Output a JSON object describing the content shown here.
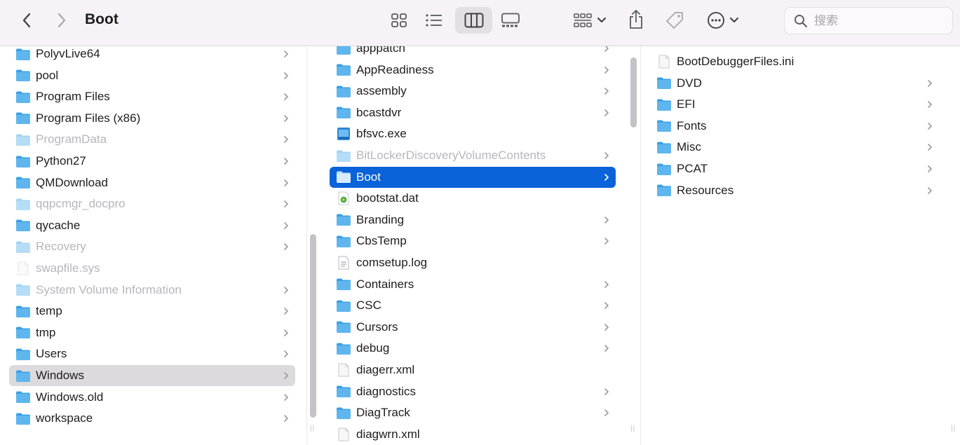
{
  "window": {
    "title": "Boot"
  },
  "toolbar": {
    "back_icon": "chevron-left-icon",
    "forward_icon": "chevron-right-icon",
    "views": [
      "icon-view",
      "list-view",
      "column-view",
      "gallery-view"
    ],
    "selected_view": "column-view",
    "group_icon": "group-icon",
    "share_icon": "share-icon",
    "tag_icon": "tag-icon",
    "more_icon": "ellipsis-icon"
  },
  "search": {
    "placeholder": "搜索",
    "value": ""
  },
  "colors": {
    "accent": "#0a63d8",
    "folder": "#5fb6ee",
    "sidebar_sel": "#dcdadd"
  },
  "column1": {
    "items": [
      {
        "name": "PolyvLive64",
        "kind": "folder",
        "dim": false,
        "chevron": true
      },
      {
        "name": "pool",
        "kind": "folder",
        "dim": false,
        "chevron": true
      },
      {
        "name": "Program Files",
        "kind": "folder",
        "dim": false,
        "chevron": true
      },
      {
        "name": "Program Files (x86)",
        "kind": "folder",
        "dim": false,
        "chevron": true
      },
      {
        "name": "ProgramData",
        "kind": "folder",
        "dim": true,
        "chevron": true
      },
      {
        "name": "Python27",
        "kind": "folder",
        "dim": false,
        "chevron": true
      },
      {
        "name": "QMDownload",
        "kind": "folder",
        "dim": false,
        "chevron": true
      },
      {
        "name": "qqpcmgr_docpro",
        "kind": "folder",
        "dim": true,
        "chevron": true
      },
      {
        "name": "qycache",
        "kind": "folder",
        "dim": false,
        "chevron": true
      },
      {
        "name": "Recovery",
        "kind": "folder",
        "dim": true,
        "chevron": true
      },
      {
        "name": "swapfile.sys",
        "kind": "file",
        "dim": true,
        "chevron": false
      },
      {
        "name": "System Volume Information",
        "kind": "folder",
        "dim": true,
        "chevron": true
      },
      {
        "name": "temp",
        "kind": "folder",
        "dim": false,
        "chevron": true
      },
      {
        "name": "tmp",
        "kind": "folder",
        "dim": false,
        "chevron": true
      },
      {
        "name": "Users",
        "kind": "folder",
        "dim": false,
        "chevron": true
      },
      {
        "name": "Windows",
        "kind": "folder",
        "dim": false,
        "chevron": true,
        "selected": "inactive"
      },
      {
        "name": "Windows.old",
        "kind": "folder",
        "dim": false,
        "chevron": true
      },
      {
        "name": "workspace",
        "kind": "folder",
        "dim": false,
        "chevron": true
      }
    ]
  },
  "column2": {
    "items": [
      {
        "name": "apppatch",
        "kind": "folder",
        "dim": false,
        "chevron": true
      },
      {
        "name": "AppReadiness",
        "kind": "folder",
        "dim": false,
        "chevron": true
      },
      {
        "name": "assembly",
        "kind": "folder",
        "dim": false,
        "chevron": true
      },
      {
        "name": "bcastdvr",
        "kind": "folder",
        "dim": false,
        "chevron": true
      },
      {
        "name": "bfsvc.exe",
        "kind": "exe",
        "dim": false,
        "chevron": false
      },
      {
        "name": "BitLockerDiscoveryVolumeContents",
        "kind": "folder",
        "dim": true,
        "chevron": true
      },
      {
        "name": "Boot",
        "kind": "folder",
        "dim": false,
        "chevron": true,
        "selected": "active"
      },
      {
        "name": "bootstat.dat",
        "kind": "dat",
        "dim": false,
        "chevron": false
      },
      {
        "name": "Branding",
        "kind": "folder",
        "dim": false,
        "chevron": true
      },
      {
        "name": "CbsTemp",
        "kind": "folder",
        "dim": false,
        "chevron": true
      },
      {
        "name": "comsetup.log",
        "kind": "text",
        "dim": false,
        "chevron": false
      },
      {
        "name": "Containers",
        "kind": "folder",
        "dim": false,
        "chevron": true
      },
      {
        "name": "CSC",
        "kind": "folder",
        "dim": false,
        "chevron": true
      },
      {
        "name": "Cursors",
        "kind": "folder",
        "dim": false,
        "chevron": true
      },
      {
        "name": "debug",
        "kind": "folder",
        "dim": false,
        "chevron": true
      },
      {
        "name": "diagerr.xml",
        "kind": "file",
        "dim": false,
        "chevron": false
      },
      {
        "name": "diagnostics",
        "kind": "folder",
        "dim": false,
        "chevron": true
      },
      {
        "name": "DiagTrack",
        "kind": "folder",
        "dim": false,
        "chevron": true
      },
      {
        "name": "diagwrn.xml",
        "kind": "file",
        "dim": false,
        "chevron": false
      }
    ]
  },
  "column3": {
    "items": [
      {
        "name": "BootDebuggerFiles.ini",
        "kind": "file",
        "dim": false,
        "chevron": false
      },
      {
        "name": "DVD",
        "kind": "folder",
        "dim": false,
        "chevron": true
      },
      {
        "name": "EFI",
        "kind": "folder",
        "dim": false,
        "chevron": true
      },
      {
        "name": "Fonts",
        "kind": "folder",
        "dim": false,
        "chevron": true
      },
      {
        "name": "Misc",
        "kind": "folder",
        "dim": false,
        "chevron": true
      },
      {
        "name": "PCAT",
        "kind": "folder",
        "dim": false,
        "chevron": true
      },
      {
        "name": "Resources",
        "kind": "folder",
        "dim": false,
        "chevron": true
      }
    ]
  }
}
